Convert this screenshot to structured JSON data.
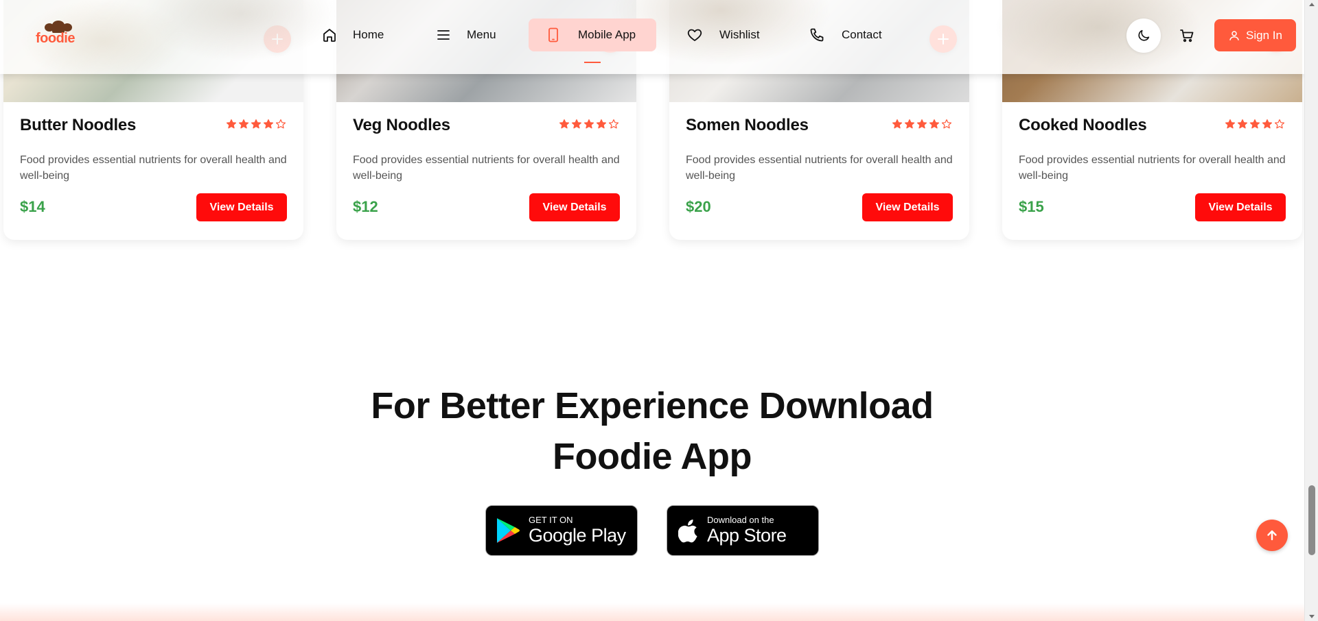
{
  "colors": {
    "accent": "#ff5a3c",
    "button_red": "#ff0b0b",
    "price_green": "#3aa24a",
    "active_nav_bg": "#ffd4d0"
  },
  "brand": {
    "logo_text": "foodie",
    "logo_icon": "chef-hat-icon"
  },
  "nav": {
    "items": [
      {
        "label": "Home",
        "icon": "home-icon",
        "active": false
      },
      {
        "label": "Menu",
        "icon": "menu-icon",
        "active": false
      },
      {
        "label": "Mobile App",
        "icon": "mobile-icon",
        "active": true
      },
      {
        "label": "Wishlist",
        "icon": "heart-icon",
        "active": false
      },
      {
        "label": "Contact",
        "icon": "phone-icon",
        "active": false
      }
    ]
  },
  "header_actions": {
    "theme_icon": "moon-icon",
    "cart_icon": "cart-icon",
    "signin_label": "Sign In",
    "signin_icon": "user-icon"
  },
  "products": [
    {
      "name": "Butter Noodles",
      "rating": 4,
      "rating_max": 5,
      "description": "Food provides essential nutrients for overall health and well-being",
      "price": "$14",
      "button_label": "View Details"
    },
    {
      "name": "Veg Noodles",
      "rating": 4,
      "rating_max": 5,
      "description": "Food provides essential nutrients for overall health and well-being",
      "price": "$12",
      "button_label": "View Details"
    },
    {
      "name": "Somen Noodles",
      "rating": 4,
      "rating_max": 5,
      "description": "Food provides essential nutrients for overall health and well-being",
      "price": "$20",
      "button_label": "View Details"
    },
    {
      "name": "Cooked Noodles",
      "rating": 4,
      "rating_max": 5,
      "description": "Food provides essential nutrients for overall health and well-being",
      "price": "$15",
      "button_label": "View Details"
    }
  ],
  "download": {
    "title_line1": "For Better Experience Download",
    "title_line2": "Foodie App",
    "google_play": {
      "small": "GET IT ON",
      "big": "Google Play",
      "icon": "google-play-icon"
    },
    "app_store": {
      "small": "Download on the",
      "big": "App Store",
      "icon": "apple-icon"
    }
  },
  "scroll_top_icon": "arrow-up-icon"
}
